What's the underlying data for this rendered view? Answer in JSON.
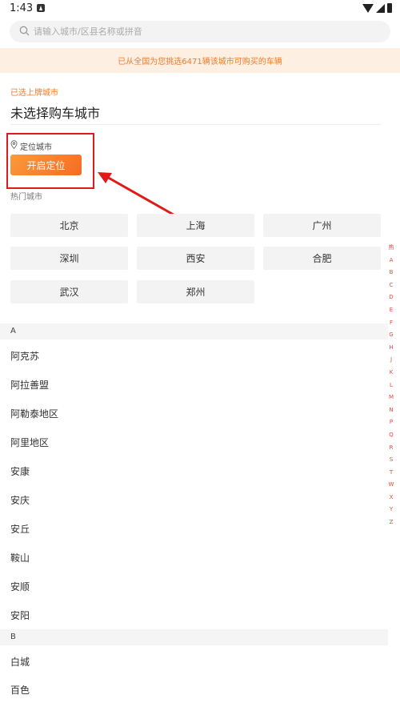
{
  "status_bar": {
    "time": "1:43"
  },
  "search": {
    "placeholder": "请输入城市/区县名称或拼音"
  },
  "notice": {
    "text": "已从全国为您挑选6471辆该城市可购买的车辆"
  },
  "selected_city": {
    "label": "已选上牌城市",
    "value": "未选择购车城市"
  },
  "locate": {
    "label": "定位城市",
    "button": "开启定位"
  },
  "hot_cities": {
    "label": "热门城市",
    "items": [
      "北京",
      "上海",
      "广州",
      "深圳",
      "西安",
      "合肥",
      "武汉",
      "郑州"
    ]
  },
  "index_letters": [
    "热",
    "A",
    "B",
    "C",
    "D",
    "E",
    "F",
    "G",
    "H",
    "J",
    "K",
    "L",
    "M",
    "N",
    "P",
    "Q",
    "R",
    "S",
    "T",
    "W",
    "X",
    "Y",
    "Z"
  ],
  "groups": [
    {
      "letter": "A",
      "cities": [
        "阿克苏",
        "阿拉善盟",
        "阿勒泰地区",
        "阿里地区",
        "安康",
        "安庆",
        "安丘",
        "鞍山",
        "安顺",
        "安阳"
      ]
    },
    {
      "letter": "B",
      "cities": [
        "白城",
        "百色"
      ]
    }
  ],
  "colors": {
    "accent": "#f07a2a",
    "highlight_box": "#e11919",
    "index": "#e8453c"
  }
}
